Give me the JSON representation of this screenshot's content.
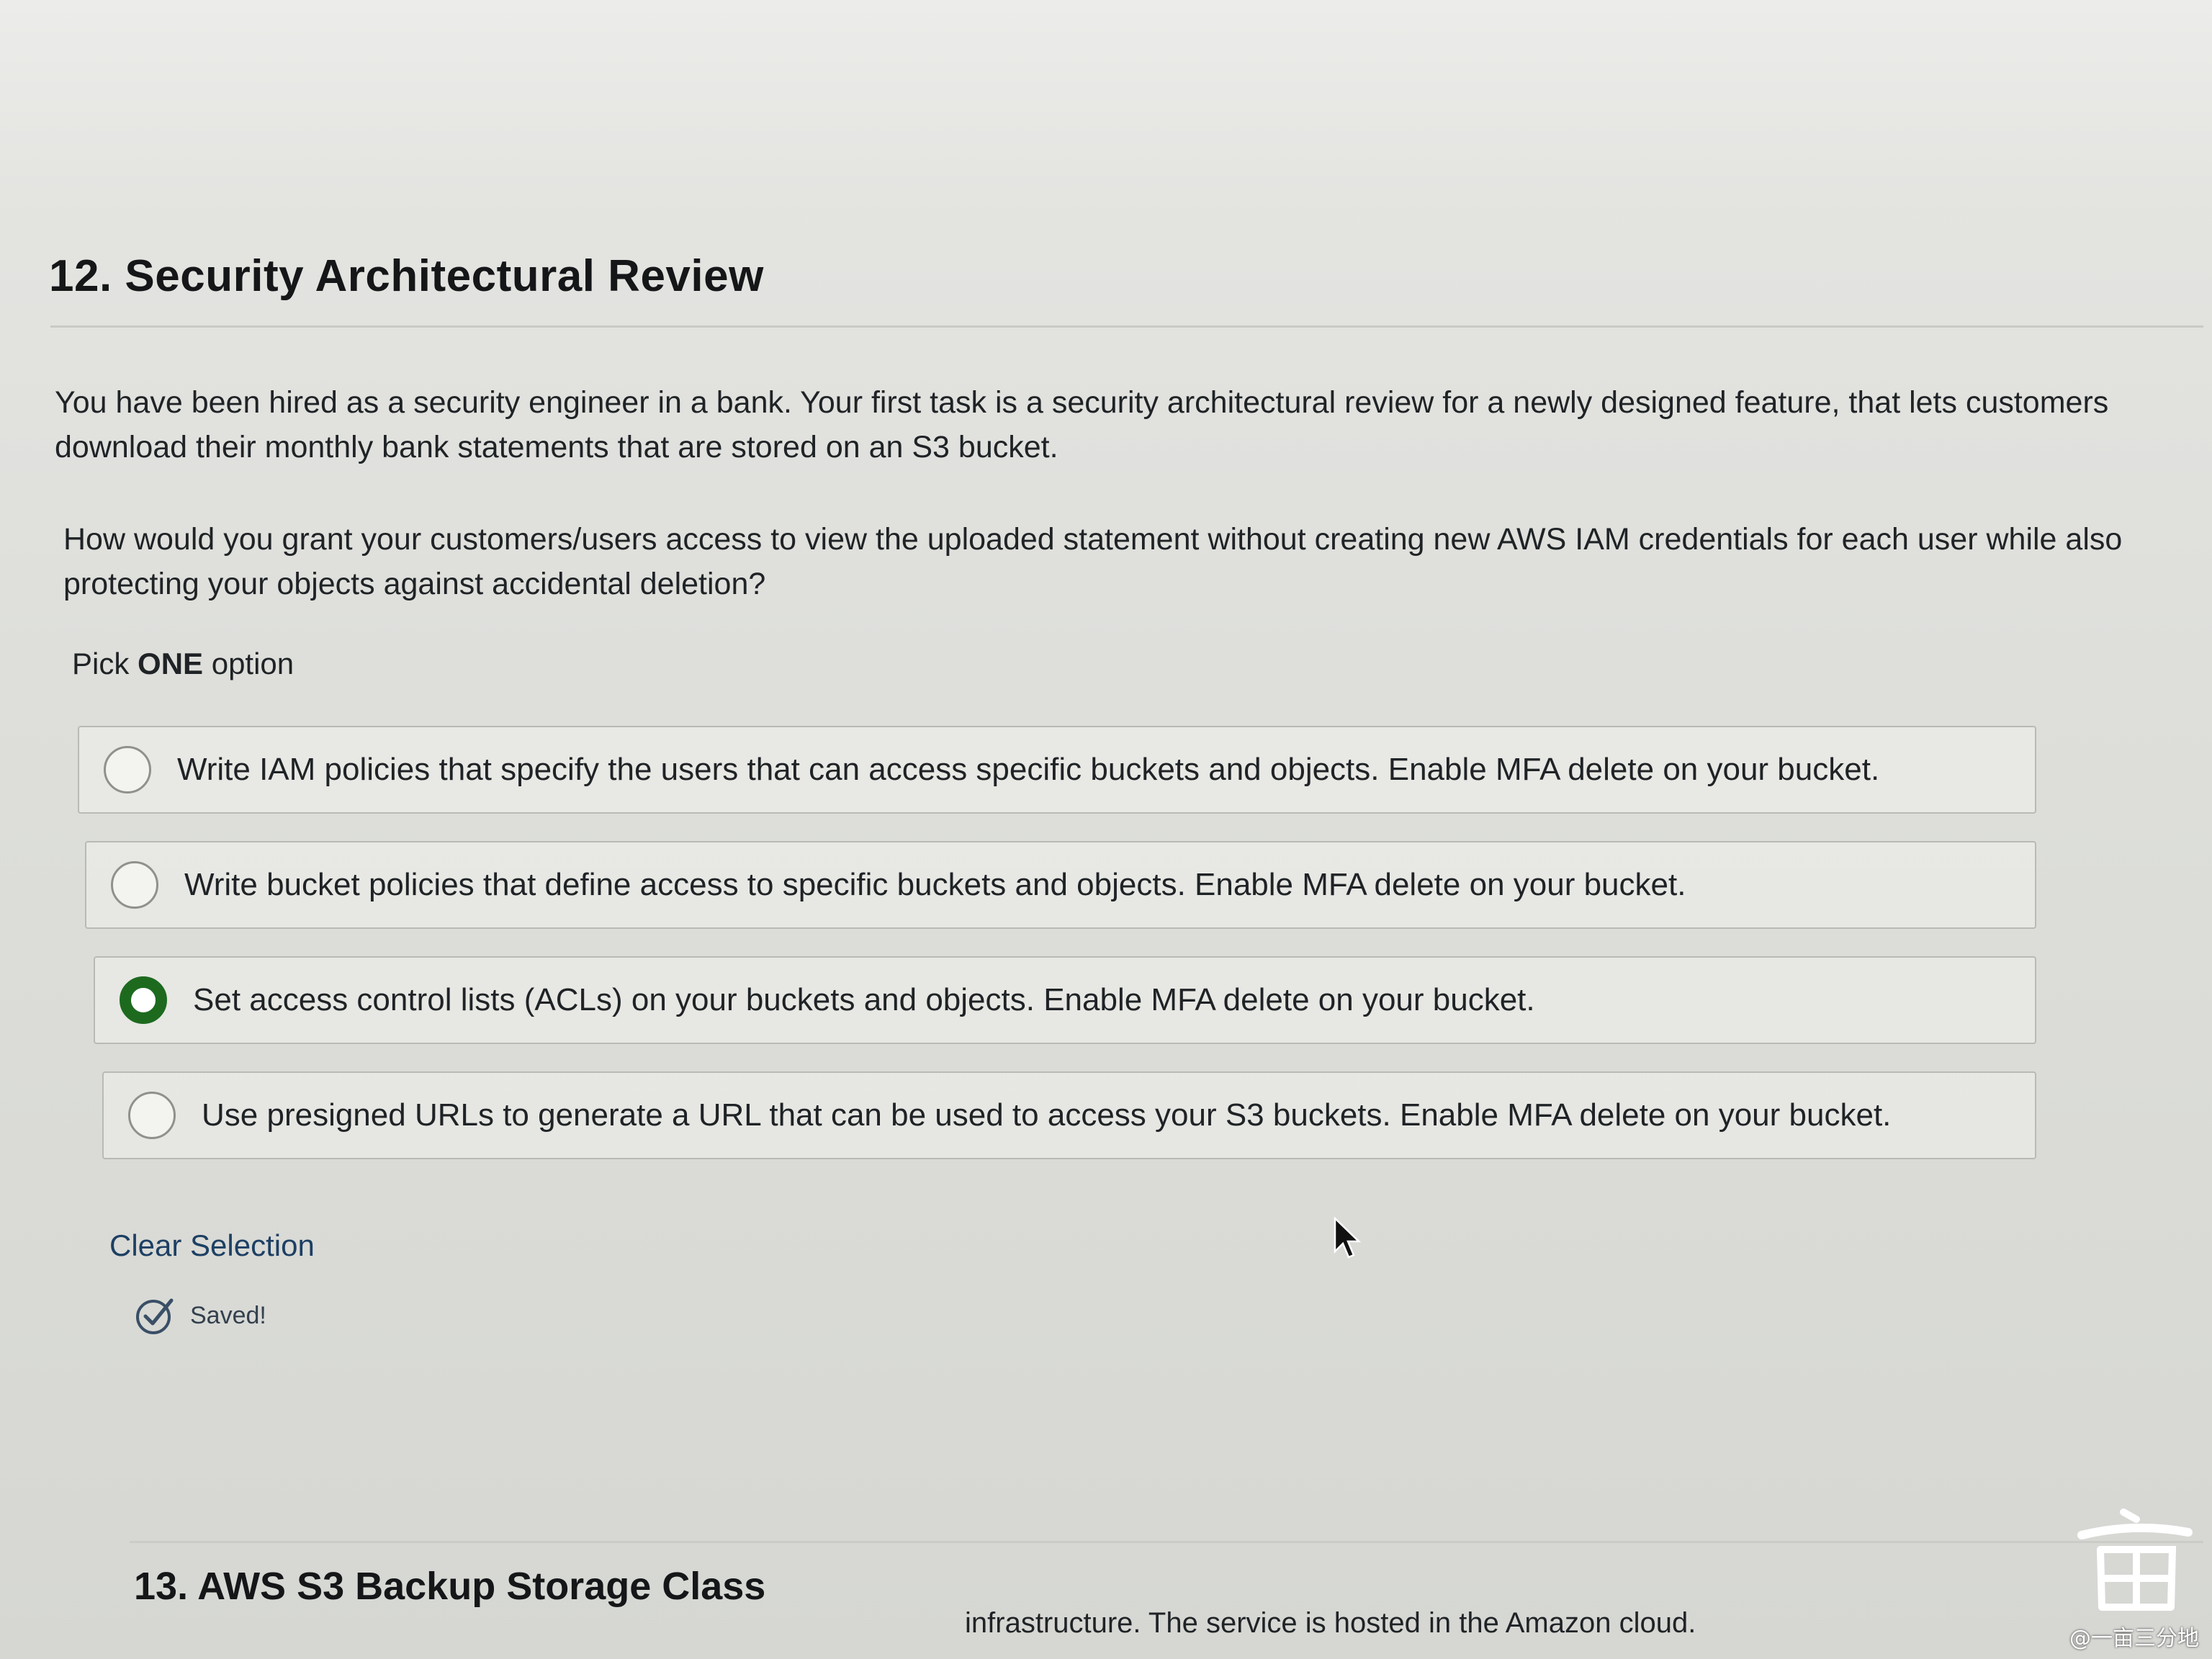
{
  "question": {
    "title": "12. Security Architectural Review",
    "paragraph_1": "You have been hired as a security engineer in a bank.  Your first task is a security architectural review for a newly designed feature, that lets customers download their monthly bank statements that are stored on an S3 bucket.",
    "paragraph_2": "How would you grant your customers/users access to view the uploaded statement without creating new AWS IAM credentials for each user while also protecting your objects against accidental deletion?",
    "pick_prefix": "Pick",
    "pick_emphasis": "ONE",
    "pick_suffix": "option",
    "options": [
      {
        "label": "Write IAM policies that specify the users that can access specific buckets and objects. Enable MFA delete on your bucket.",
        "selected": false
      },
      {
        "label": "Write bucket policies that define access to specific buckets and objects. Enable MFA delete on your bucket.",
        "selected": false
      },
      {
        "label": "Set access control lists (ACLs) on your buckets and objects. Enable MFA delete on your bucket.",
        "selected": true
      },
      {
        "label": "Use presigned URLs to generate a URL that can be used to access your S3 buckets. Enable MFA delete on your bucket.",
        "selected": false
      }
    ],
    "clear_label": "Clear Selection",
    "saved_label": "Saved!"
  },
  "next_question": {
    "title": "13. AWS S3 Backup Storage Class",
    "snippet": "infrastructure. The service is hosted in the Amazon cloud."
  },
  "watermark": {
    "handle": "@一亩三分地"
  },
  "colors": {
    "selected_radio": "#1d6a1f",
    "link": "#1d3f63"
  }
}
